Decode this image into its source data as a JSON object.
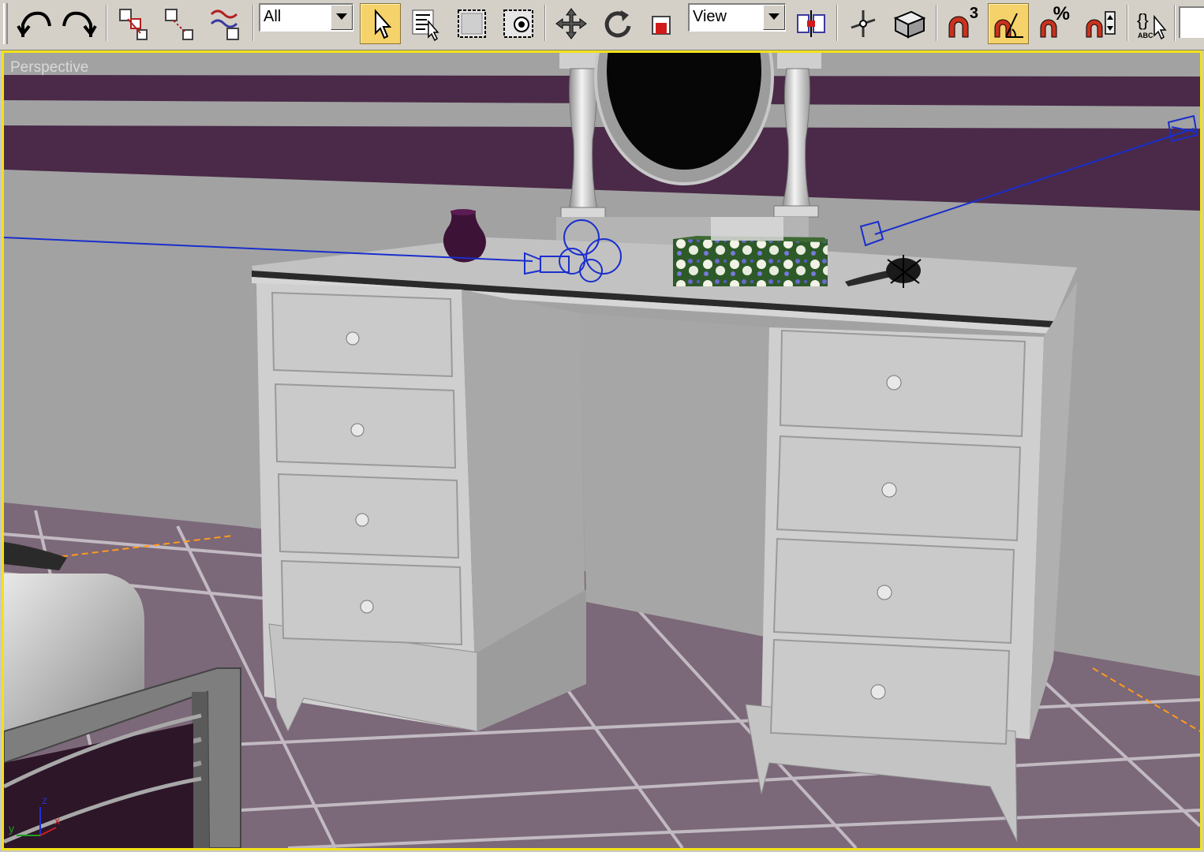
{
  "toolbar": {
    "selection_filter": {
      "value": "All"
    },
    "reference_coord": {
      "value": "View"
    },
    "snap_toggle_label": "3",
    "percent_snap_label": "%",
    "named_selection_label": "ABC",
    "buttons": [
      {
        "name": "undo",
        "icon": "undo-icon"
      },
      {
        "name": "redo",
        "icon": "redo-icon"
      },
      {
        "name": "select-and-link",
        "icon": "link-icon"
      },
      {
        "name": "unlink-selection",
        "icon": "unlink-icon"
      },
      {
        "name": "bind-to-space-warp",
        "icon": "space-warp-icon"
      },
      {
        "name": "select-object",
        "icon": "cursor-arrow-icon",
        "active": true
      },
      {
        "name": "select-by-name",
        "icon": "select-by-name-icon"
      },
      {
        "name": "rectangular-selection-region",
        "icon": "rect-selection-icon"
      },
      {
        "name": "window-crossing",
        "icon": "window-crossing-icon"
      },
      {
        "name": "select-and-move",
        "icon": "move-icon"
      },
      {
        "name": "select-and-rotate",
        "icon": "rotate-icon"
      },
      {
        "name": "select-and-scale",
        "icon": "scale-icon"
      },
      {
        "name": "use-pivot-point-center",
        "icon": "pivot-center-icon"
      },
      {
        "name": "select-and-manipulate",
        "icon": "manipulate-icon"
      },
      {
        "name": "keyboard-shortcut-override",
        "icon": "keyboard-override-icon"
      },
      {
        "name": "snaps-toggle",
        "icon": "snap-magnet-icon"
      },
      {
        "name": "angle-snap-toggle",
        "icon": "angle-snap-icon",
        "active": true
      },
      {
        "name": "percent-snap-toggle",
        "icon": "percent-snap-icon"
      },
      {
        "name": "spinner-snap-toggle",
        "icon": "spinner-snap-icon"
      },
      {
        "name": "edit-named-selection-sets",
        "icon": "named-selection-icon"
      }
    ]
  },
  "viewport": {
    "label": "Perspective",
    "border_color": "#f2e21a",
    "axis": {
      "z": "z",
      "x": "x",
      "y": "y"
    }
  },
  "colors": {
    "toolbar_bg": "#d4d0c8",
    "active_button": "#f5d36a",
    "wall": "#a2a2a2",
    "wall_stripe": "#4a2a48",
    "floor_tile": "#7b6878",
    "furniture": "#c9c9c9",
    "camera_gizmo": "#1a2ecc",
    "grid_dashed": "#ff9a1e"
  }
}
